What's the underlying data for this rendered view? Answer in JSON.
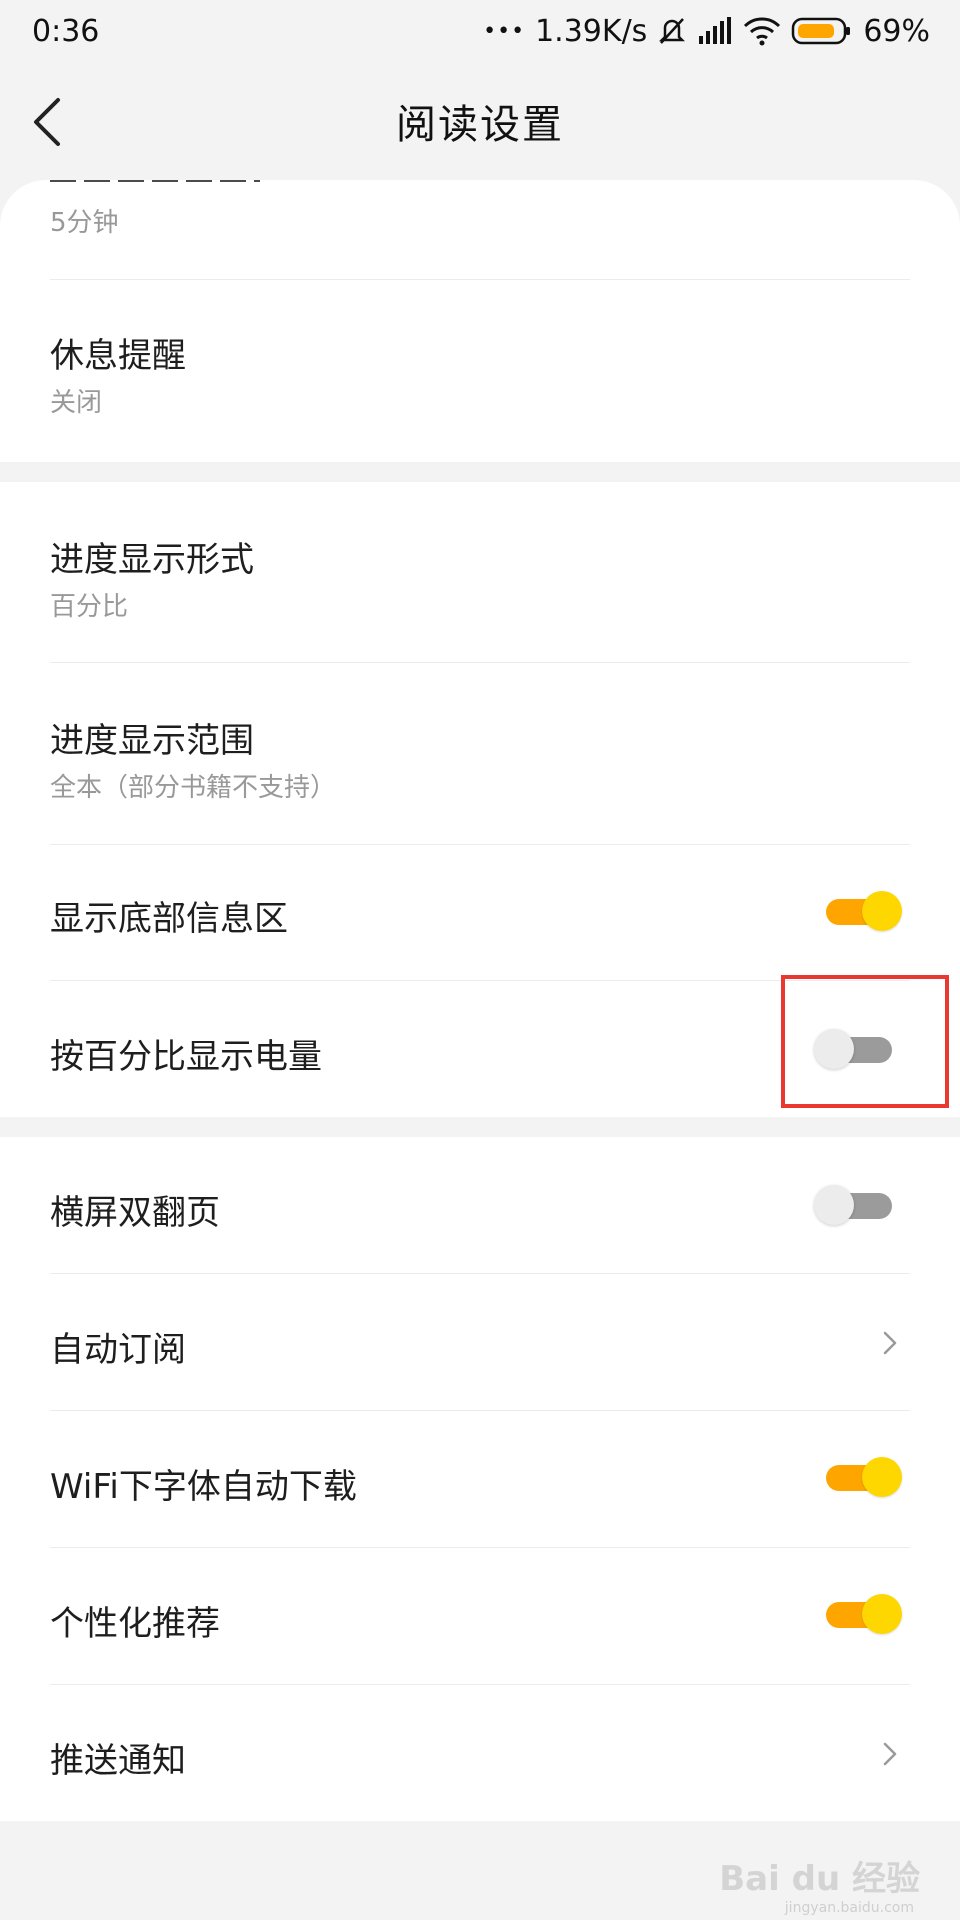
{
  "status_bar": {
    "time": "0:36",
    "dots": "•••",
    "net_speed": "1.39K/s",
    "battery": "69%",
    "icons": [
      "mute-icon",
      "signal-icon",
      "wifi-icon",
      "battery-icon"
    ]
  },
  "header": {
    "title": "阅读设置"
  },
  "sections": {
    "top": {
      "partial_item_sub": "5分钟",
      "rest_reminder": {
        "label": "休息提醒",
        "sub": "关闭"
      }
    },
    "middle": {
      "progress_format": {
        "label": "进度显示形式",
        "sub": "百分比"
      },
      "progress_range": {
        "label": "进度显示范围",
        "sub": "全本（部分书籍不支持）"
      },
      "bottom_info": {
        "label": "显示底部信息区",
        "toggle": "on"
      },
      "battery_percent": {
        "label": "按百分比显示电量",
        "toggle": "off"
      }
    },
    "bottom": {
      "landscape_double": {
        "label": "横屏双翻页",
        "toggle": "off"
      },
      "auto_subscribe": {
        "label": "自动订阅"
      },
      "wifi_font_download": {
        "label": "WiFi下字体自动下载",
        "toggle": "on"
      },
      "personalized": {
        "label": "个性化推荐",
        "toggle": "on"
      },
      "push_notify": {
        "label": "推送通知"
      }
    }
  },
  "colors": {
    "accent_track": "#ffa500",
    "accent_knob": "#ffd700",
    "highlight_box": "#e8382f"
  },
  "watermark": {
    "main": "Bai du 经验",
    "sub": "jingyan.baidu.com"
  }
}
